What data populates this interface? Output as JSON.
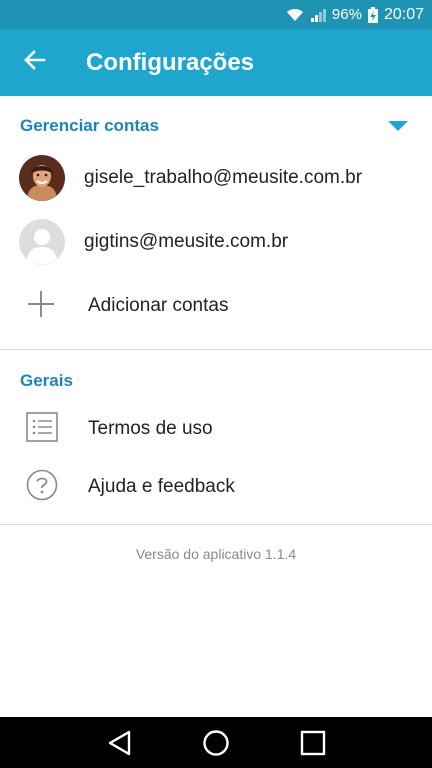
{
  "status_bar": {
    "battery": "96%",
    "time": "20:07",
    "icons": [
      "wifi-icon",
      "signal-icon",
      "battery-charging-icon"
    ]
  },
  "app_bar": {
    "title": "Configurações",
    "back_icon": "arrow-left-icon"
  },
  "accounts_section": {
    "header": "Gerenciar contas",
    "toggle_icon": "caret-down-icon",
    "accounts": [
      {
        "email": "gisele_trabalho@meusite.com.br",
        "avatar": "photo-avatar"
      },
      {
        "email": "gigtins@meusite.com.br",
        "avatar": "default-avatar"
      }
    ],
    "add_label": "Adicionar contas",
    "add_icon": "plus-icon"
  },
  "general_section": {
    "header": "Gerais",
    "items": [
      {
        "label": "Termos de uso",
        "icon": "list-icon"
      },
      {
        "label": "Ajuda e feedback",
        "icon": "help-circle-icon"
      }
    ]
  },
  "footer": {
    "version": "Versão do aplicativo 1.1.4"
  },
  "nav_bar": {
    "icons": [
      "back-triangle-icon",
      "home-circle-icon",
      "recents-square-icon"
    ]
  },
  "colors": {
    "status_bar": "#1f93b3",
    "app_bar": "#1ea6cf",
    "section_header": "#1a86b8"
  }
}
